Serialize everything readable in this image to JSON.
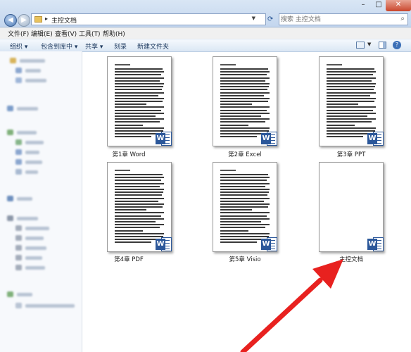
{
  "window": {
    "address_path": "主控文档",
    "search_placeholder": "搜索 主控文档",
    "controls": {
      "minimize": "–",
      "maximize": "□",
      "close": "✕"
    }
  },
  "menubar": {
    "items": [
      "文件(F)",
      "编辑(E)",
      "查看(V)",
      "工具(T)",
      "帮助(H)"
    ]
  },
  "commandbar": {
    "organize": "组织 ▾",
    "include_library": "包含到库中 ▾",
    "share": "共享 ▾",
    "burn": "刻录",
    "new_folder": "新建文件夹"
  },
  "files": [
    {
      "name": "第1章 Word",
      "page_heading": "第1章 Word",
      "has_text": true
    },
    {
      "name": "第2章 Excel",
      "page_heading": "第2章 Excel",
      "has_text": true
    },
    {
      "name": "第3章 PPT",
      "page_heading": "第3章 PPT",
      "has_text": true
    },
    {
      "name": "第4章 PDF",
      "page_heading": "第4章 PDF",
      "has_text": true
    },
    {
      "name": "第5章 Visio",
      "page_heading": "第5章 Visio",
      "has_text": true
    },
    {
      "name": "主控文档",
      "page_heading": "",
      "has_text": false
    }
  ],
  "icons": {
    "back": "back-arrow-icon",
    "forward": "forward-arrow-icon",
    "folder": "folder-icon",
    "refresh": "refresh-icon",
    "search": "search-icon",
    "word": "word-document-icon",
    "help": "help-icon"
  },
  "colors": {
    "annotation_arrow": "#e8211f",
    "word_blue": "#2b579a",
    "titlebar": "#c3d6ee"
  }
}
